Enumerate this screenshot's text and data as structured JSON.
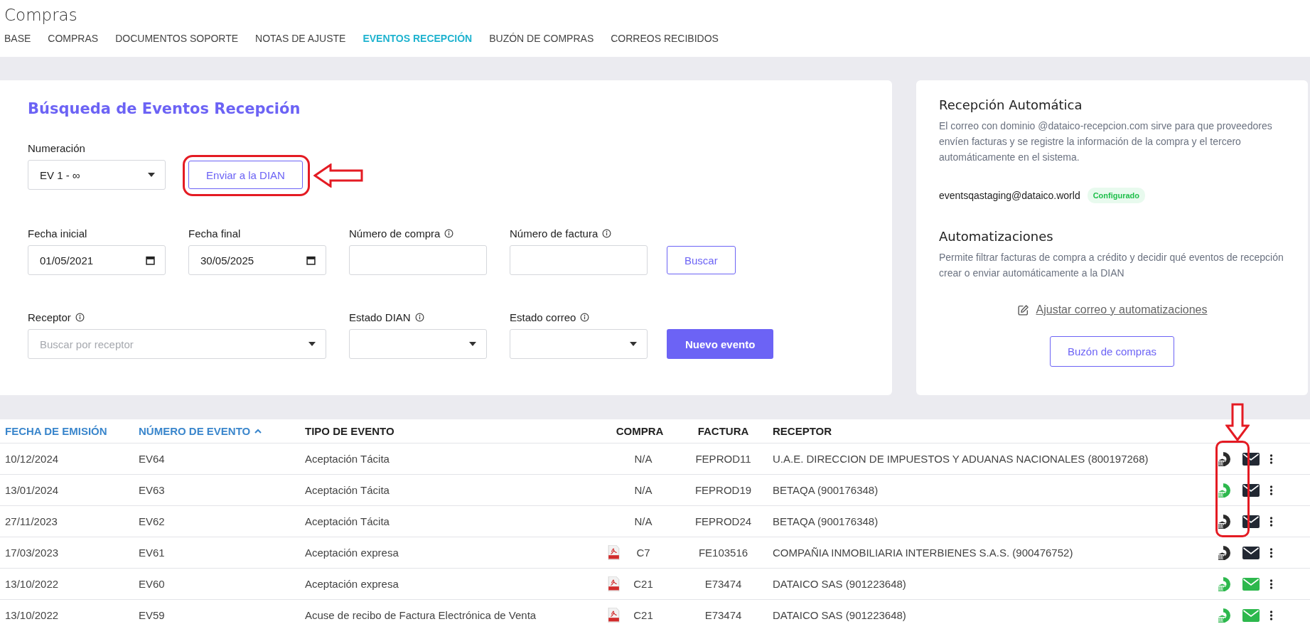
{
  "page": {
    "title": "Compras"
  },
  "tabs": [
    {
      "label": "BASE",
      "selected": false
    },
    {
      "label": "COMPRAS",
      "selected": false
    },
    {
      "label": "DOCUMENTOS SOPORTE",
      "selected": false
    },
    {
      "label": "NOTAS DE AJUSTE",
      "selected": false
    },
    {
      "label": "EVENTOS RECEPCIÓN",
      "selected": true
    },
    {
      "label": "BUZÓN DE COMPRAS",
      "selected": false
    },
    {
      "label": "CORREOS RECIBIDOS",
      "selected": false
    }
  ],
  "search_panel": {
    "title": "Búsqueda de Eventos Recepción",
    "numeracion": {
      "label": "Numeración",
      "value": "EV 1 - ∞"
    },
    "send_button": {
      "label": "Enviar a la DIAN",
      "highlighted": true
    },
    "filters_row_1": [
      {
        "kind": "date",
        "label": "Fecha inicial",
        "info": false,
        "value": "01/05/2021"
      },
      {
        "kind": "date",
        "label": "Fecha final",
        "info": false,
        "value": "30/05/2025"
      },
      {
        "kind": "text",
        "label": "Número de compra",
        "info": true
      },
      {
        "kind": "text",
        "label": "Número de factura",
        "info": true
      }
    ],
    "search_button": "Buscar",
    "filters_row_2": [
      {
        "kind": "wide-select",
        "label": "Receptor",
        "info": true,
        "placeholder": "Buscar por receptor"
      },
      {
        "kind": "select",
        "label": "Estado DIAN",
        "info": true
      },
      {
        "kind": "select",
        "label": "Estado correo",
        "info": true
      }
    ],
    "new_button": "Nuevo evento"
  },
  "auto_panel": {
    "title": "Recepción Automática",
    "description": "El correo con dominio @dataico-recepcion.com sirve para que proveedores envíen facturas y se registre la información de la compra y el tercero automáticamente en el sistema.",
    "email": "eventsqastaging@dataico.world",
    "badge": "Configurado",
    "automation_title": "Automatizaciones",
    "automation_description": "Permite filtrar facturas de compra a crédito y decidir qué eventos de recepción crear o enviar automáticamente a la DIAN",
    "link": "Ajustar correo y automatizaciones",
    "button": "Buzón de compras"
  },
  "table": {
    "columns": [
      {
        "label": "FECHA DE EMISIÓN",
        "sortable": true,
        "sorted": false
      },
      {
        "label": "NÚMERO DE EVENTO",
        "sortable": true,
        "sorted": true
      },
      {
        "label": "TIPO DE EVENTO",
        "sortable": false,
        "sorted": false
      },
      {
        "label": "COMPRA",
        "sortable": false,
        "sorted": false
      },
      {
        "label": "FACTURA",
        "sortable": false,
        "sorted": false
      },
      {
        "label": "RECEPTOR",
        "sortable": false,
        "sorted": false
      }
    ],
    "rows": [
      {
        "date": "10/12/2024",
        "event": "EV64",
        "type": "Aceptación Tácita",
        "has_pdf": false,
        "purchase": "N/A",
        "invoice": "FEPROD11",
        "receiver": "U.A.E. DIRECCION DE IMPUESTOS Y ADUANAS NACIONALES (800197268)",
        "dian": {
          "color": "#2b2b2b"
        },
        "email": {
          "color": "#222833"
        },
        "highlighted": true
      },
      {
        "date": "13/01/2024",
        "event": "EV63",
        "type": "Aceptación Tácita",
        "has_pdf": false,
        "purchase": "N/A",
        "invoice": "FEPROD19",
        "receiver": "BETAQA (900176348)",
        "dian": {
          "color": "#2db84d"
        },
        "email": {
          "color": "#222833"
        },
        "highlighted": true
      },
      {
        "date": "27/11/2023",
        "event": "EV62",
        "type": "Aceptación Tácita",
        "has_pdf": false,
        "purchase": "N/A",
        "invoice": "FEPROD24",
        "receiver": "BETAQA (900176348)",
        "dian": {
          "color": "#2b2b2b"
        },
        "email": {
          "color": "#222833"
        },
        "highlighted": true
      },
      {
        "date": "17/03/2023",
        "event": "EV61",
        "type": "Aceptación expresa",
        "has_pdf": true,
        "purchase": "C7",
        "invoice": "FE103516",
        "receiver": "COMPAÑIA INMOBILIARIA INTERBIENES S.A.S. (900476752)",
        "dian": {
          "color": "#2b2b2b"
        },
        "email": {
          "color": "#222833"
        },
        "highlighted": false
      },
      {
        "date": "13/10/2022",
        "event": "EV60",
        "type": "Aceptación expresa",
        "has_pdf": true,
        "purchase": "C21",
        "invoice": "E73474",
        "receiver": "DATAICO SAS (901223648)",
        "dian": {
          "color": "#2db84d"
        },
        "email": {
          "color": "#2db84d"
        },
        "highlighted": false
      },
      {
        "date": "13/10/2022",
        "event": "EV59",
        "type": "Acuse de recibo de Factura Electrónica de Venta",
        "has_pdf": true,
        "purchase": "C21",
        "invoice": "E73474",
        "receiver": "DATAICO SAS (901223648)",
        "dian": {
          "color": "#2db84d"
        },
        "email": {
          "color": "#2db84d"
        },
        "highlighted": false
      }
    ]
  }
}
